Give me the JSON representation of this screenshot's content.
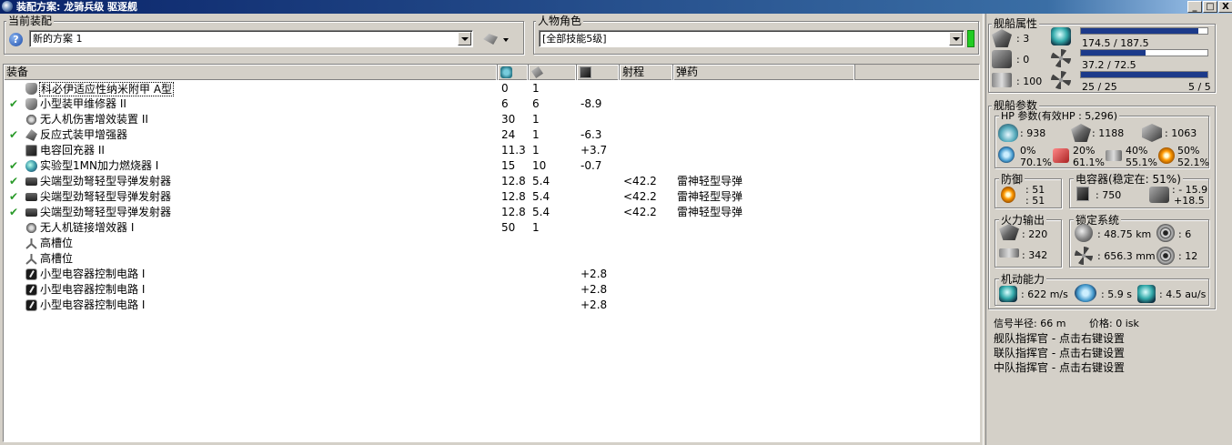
{
  "window": {
    "title": "装配方案: 龙骑兵级 驱逐舰",
    "min": "_",
    "max": "□",
    "close": "X"
  },
  "current_fit": {
    "label": "当前装配",
    "help": "?",
    "value": "新的方案 1"
  },
  "character": {
    "label": "人物角色",
    "value": "[全部技能5级]"
  },
  "list": {
    "headers": {
      "equipment": "装备",
      "cpu": "",
      "pg": "",
      "cap": "",
      "range": "射程",
      "ammo": "弹药"
    },
    "rows": [
      {
        "check": "",
        "icon": "armor-plate-icon",
        "name": "科必伊适应性纳米附甲 A型",
        "cpu": "0",
        "pg": "1",
        "cap": "",
        "range": "",
        "ammo": ""
      },
      {
        "check": "✔",
        "icon": "armor-repairer-icon",
        "name": "小型装甲维修器 II",
        "cpu": "6",
        "pg": "6",
        "cap": "-8.9",
        "range": "",
        "ammo": ""
      },
      {
        "check": "",
        "icon": "drone-damage-icon",
        "name": "无人机伤害增效装置 II",
        "cpu": "30",
        "pg": "1",
        "cap": "",
        "range": "",
        "ammo": ""
      },
      {
        "check": "✔",
        "icon": "hardener-icon",
        "name": "反应式装甲增强器",
        "cpu": "24",
        "pg": "1",
        "cap": "-6.3",
        "range": "",
        "ammo": ""
      },
      {
        "check": "",
        "icon": "cap-recharger-icon",
        "name": "电容回充器 II",
        "cpu": "11.3",
        "pg": "1",
        "cap": "+3.7",
        "range": "",
        "ammo": ""
      },
      {
        "check": "✔",
        "icon": "afterburner-icon",
        "name": "实验型1MN加力燃烧器 I",
        "cpu": "15",
        "pg": "10",
        "cap": "-0.7",
        "range": "",
        "ammo": ""
      },
      {
        "check": "✔",
        "icon": "launcher-icon",
        "name": "尖端型劲弩轻型导弹发射器",
        "cpu": "12.8",
        "pg": "5.4",
        "cap": "",
        "range": "<42.2",
        "ammo": "雷神轻型导弹"
      },
      {
        "check": "✔",
        "icon": "launcher-icon",
        "name": "尖端型劲弩轻型导弹发射器",
        "cpu": "12.8",
        "pg": "5.4",
        "cap": "",
        "range": "<42.2",
        "ammo": "雷神轻型导弹"
      },
      {
        "check": "✔",
        "icon": "launcher-icon",
        "name": "尖端型劲弩轻型导弹发射器",
        "cpu": "12.8",
        "pg": "5.4",
        "cap": "",
        "range": "<42.2",
        "ammo": "雷神轻型导弹"
      },
      {
        "check": "",
        "icon": "drone-link-icon",
        "name": "无人机链接增效器 I",
        "cpu": "50",
        "pg": "1",
        "cap": "",
        "range": "",
        "ammo": ""
      },
      {
        "check": "",
        "icon": "high-slot-icon",
        "name": "高槽位",
        "cpu": "",
        "pg": "",
        "cap": "",
        "range": "",
        "ammo": ""
      },
      {
        "check": "",
        "icon": "high-slot-icon",
        "name": "高槽位",
        "cpu": "",
        "pg": "",
        "cap": "",
        "range": "",
        "ammo": ""
      },
      {
        "check": "",
        "icon": "rig-icon",
        "name": "小型电容器控制电路 I",
        "cpu": "",
        "pg": "",
        "cap": "+2.8",
        "range": "",
        "ammo": ""
      },
      {
        "check": "",
        "icon": "rig-icon",
        "name": "小型电容器控制电路 I",
        "cpu": "",
        "pg": "",
        "cap": "+2.8",
        "range": "",
        "ammo": ""
      },
      {
        "check": "",
        "icon": "rig-icon",
        "name": "小型电容器控制电路 I",
        "cpu": "",
        "pg": "",
        "cap": "+2.8",
        "range": "",
        "ammo": ""
      }
    ]
  },
  "ship_attrs": {
    "label": "舰船属性",
    "turret": ": 3",
    "launcher": ": 0",
    "calibration": ": 100",
    "cpu_text": "174.5 / 187.5",
    "cpu_fraction": 0.93,
    "pg_text": "37.2 / 72.5",
    "pg_fraction": 0.51,
    "drone_text": "25 / 25",
    "drone_fraction": 1.0,
    "drone_count": "5 / 5"
  },
  "ship_params": {
    "label": "舰船参数",
    "hp_label": "HP 参数(有效HP : 5,296)",
    "shield_hp": ": 938",
    "armor_hp": ": 1188",
    "structure_hp": ": 1063",
    "res_em_top": "0%",
    "res_em_bot": "70.1%",
    "res_th_top": "20%",
    "res_th_bot": "61.1%",
    "res_kin_top": "40%",
    "res_kin_bot": "55.1%",
    "res_exp_top": "50%",
    "res_exp_bot": "52.1%",
    "defense_label": "防御",
    "def_top": ": 51",
    "def_bot": ": 51",
    "cap_label": "电容器(稳定在: 51%)",
    "cap_amount": ": 750",
    "cap_delta_top": ": - 15.9",
    "cap_delta_bot": "+18.5",
    "firepower_label": "火力输出",
    "dps": ": 220",
    "volley": ": 342",
    "targeting_label": "锁定系统",
    "lock_range": ": 48.75 km",
    "max_targets": ": 6",
    "scan_res": ": 656.3 mm",
    "sensor_strength": ": 12",
    "mobility_label": "机动能力",
    "speed": ": 622 m/s",
    "align": ": 5.9 s",
    "warp": ": 4.5 au/s"
  },
  "footer": {
    "sig_radius": "信号半径: 66 m",
    "price": "价格: 0 isk",
    "fleet_cmd": "舰队指挥官 - 点击右键设置",
    "wing_cmd": "联队指挥官 - 点击右键设置",
    "squad_cmd": "中队指挥官 - 点击右键设置"
  }
}
